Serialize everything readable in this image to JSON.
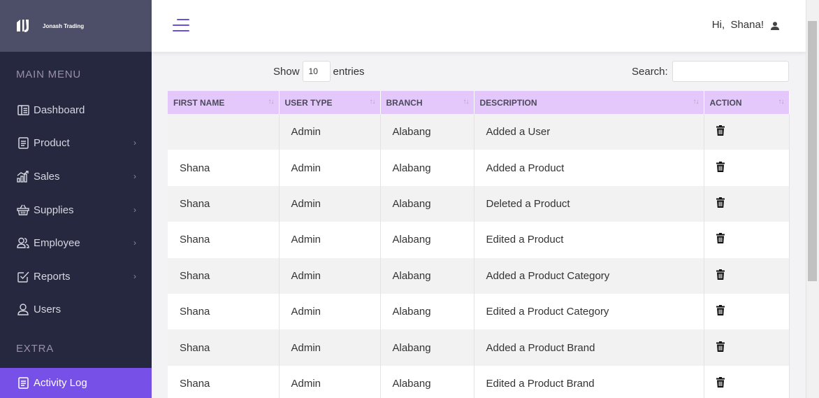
{
  "brand": {
    "name": "Jonash Trading"
  },
  "sidebar": {
    "main_heading": "MAIN MENU",
    "items": [
      {
        "label": "Dashboard",
        "icon": "dashboard-icon",
        "has_submenu": false
      },
      {
        "label": "Product",
        "icon": "document-icon",
        "has_submenu": true
      },
      {
        "label": "Sales",
        "icon": "chart-bars-icon",
        "has_submenu": true
      },
      {
        "label": "Supplies",
        "icon": "basket-icon",
        "has_submenu": true
      },
      {
        "label": "Employee",
        "icon": "users-icon",
        "has_submenu": true
      },
      {
        "label": "Reports",
        "icon": "checkbox-icon",
        "has_submenu": true
      },
      {
        "label": "Users",
        "icon": "user-icon",
        "has_submenu": false
      }
    ],
    "extra_heading": "EXTRA",
    "extra_items": [
      {
        "label": "Activity Log",
        "icon": "document-icon",
        "active": true
      }
    ]
  },
  "header": {
    "greeting": "Hi,  Shana!"
  },
  "controls": {
    "show_label": "Show",
    "entries_value": "10",
    "entries_label": "entries",
    "search_label": "Search:",
    "search_value": ""
  },
  "table": {
    "columns": [
      "FIRST NAME",
      "USER TYPE",
      "BRANCH",
      "DESCRIPTION",
      "ACTION"
    ],
    "rows": [
      {
        "first_name": "",
        "user_type": "Admin",
        "branch": "Alabang",
        "description": "Added a User"
      },
      {
        "first_name": "Shana",
        "user_type": "Admin",
        "branch": "Alabang",
        "description": "Added a Product"
      },
      {
        "first_name": "Shana",
        "user_type": "Admin",
        "branch": "Alabang",
        "description": "Deleted a Product"
      },
      {
        "first_name": "Shana",
        "user_type": "Admin",
        "branch": "Alabang",
        "description": "Edited a Product"
      },
      {
        "first_name": "Shana",
        "user_type": "Admin",
        "branch": "Alabang",
        "description": "Added a Product Category"
      },
      {
        "first_name": "Shana",
        "user_type": "Admin",
        "branch": "Alabang",
        "description": "Edited a Product Category"
      },
      {
        "first_name": "Shana",
        "user_type": "Admin",
        "branch": "Alabang",
        "description": "Added a Product Brand"
      },
      {
        "first_name": "Shana",
        "user_type": "Admin",
        "branch": "Alabang",
        "description": "Edited a Product Brand"
      }
    ]
  },
  "colors": {
    "sidebar_bg": "#262840",
    "brand_bg": "#4d4f68",
    "accent": "#7750e8",
    "table_header_bg": "#e5c8fb"
  }
}
